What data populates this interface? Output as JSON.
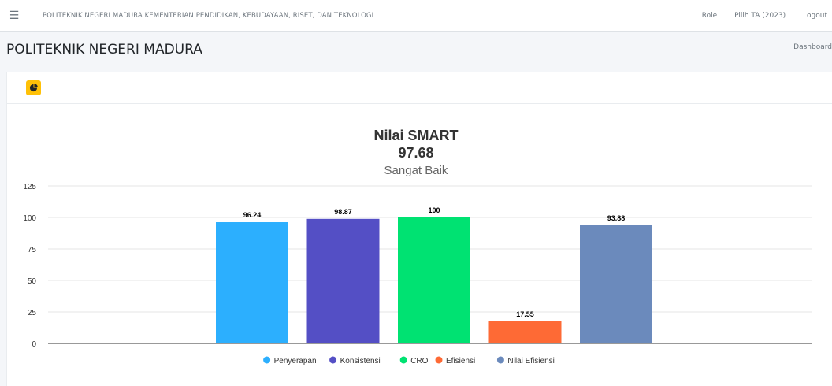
{
  "navbar": {
    "menu_icon": "hamburger-icon",
    "title": "POLITEKNIK NEGERI MADURA KEMENTERIAN PENDIDIKAN, KEBUDAYAAN, RISET, DAN TEKNOLOGI",
    "links": [
      "Role",
      "Pilih TA (2023)",
      "Logout"
    ]
  },
  "header": {
    "title": "POLITEKNIK NEGERI MADURA",
    "breadcrumb": "Dashboard"
  },
  "card": {
    "tool_icon": "pie-chart-icon",
    "tool_color": "#ffc107"
  },
  "chart_data": {
    "type": "bar",
    "title": "Nilai SMART",
    "subtitle_value": "97.68",
    "subtitle": "Sangat Baik",
    "categories": [
      "Penyerapan",
      "Konsistensi",
      "CRO",
      "Efisiensi",
      "Nilai Efisiensi"
    ],
    "values": [
      96.24,
      98.87,
      100,
      17.55,
      93.88
    ],
    "value_labels": [
      "96.24",
      "98.87",
      "100",
      "17.55",
      "93.88"
    ],
    "colors": [
      "#2caffe",
      "#544fc5",
      "#00e272",
      "#fe6a35",
      "#6b8abc"
    ],
    "yticks": [
      "0",
      "25",
      "50",
      "75",
      "100",
      "125"
    ],
    "ylim": [
      0,
      125
    ],
    "grid": true,
    "legend": "bottom-center"
  }
}
